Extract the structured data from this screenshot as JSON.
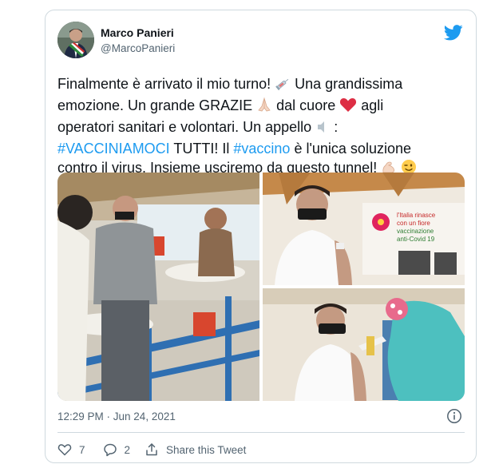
{
  "author": {
    "display_name": "Marco Panieri",
    "handle": "@MarcoPanieri",
    "avatar_icon": "profile-photo"
  },
  "brand_icon": "twitter-bird-icon",
  "brand_color": "#1d9bf0",
  "tweet": {
    "line1": "Finalmente è arrivato il mio turno!",
    "line1b": "Una grandissima",
    "line2a": "emozione. Un grande GRAZIE",
    "line2b": "dal cuore",
    "line2c": "agli",
    "line3": "operatori sanitari e volontari. Un appello",
    "line3b": ":",
    "hashtag1": "#VACCINIAMOCI",
    "line4a": "TUTTI! Il",
    "hashtag2": "#vaccino",
    "line4b": "è l'unica soluzione",
    "line5": "contro il virus. Insieme usciremo da questo tunnel!"
  },
  "media": {
    "photo3_sign_line1": "l'Italia rinasce",
    "photo3_sign_line2": "con un fiore",
    "photo3_sign_line3": "vaccinazione",
    "photo3_sign_line4": "anti-Covid 19"
  },
  "timestamp": "12:29 PM · Jun 24, 2021",
  "actions": {
    "likes": "7",
    "replies": "2",
    "share_label": "Share this Tweet"
  }
}
